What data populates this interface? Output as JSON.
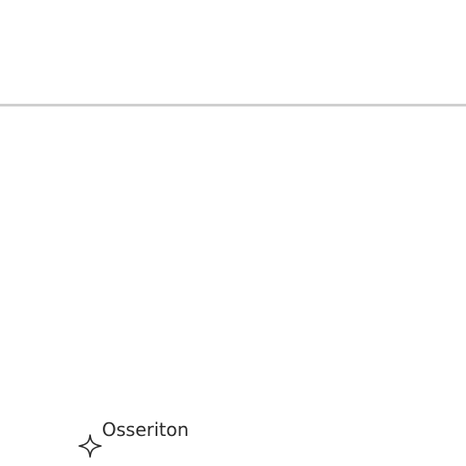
{
  "brand": {
    "name": "Osseriton",
    "icon": "sparkle-icon",
    "text_color": "#2b2b2b"
  },
  "divider": {
    "color": "#cfcfcf"
  }
}
